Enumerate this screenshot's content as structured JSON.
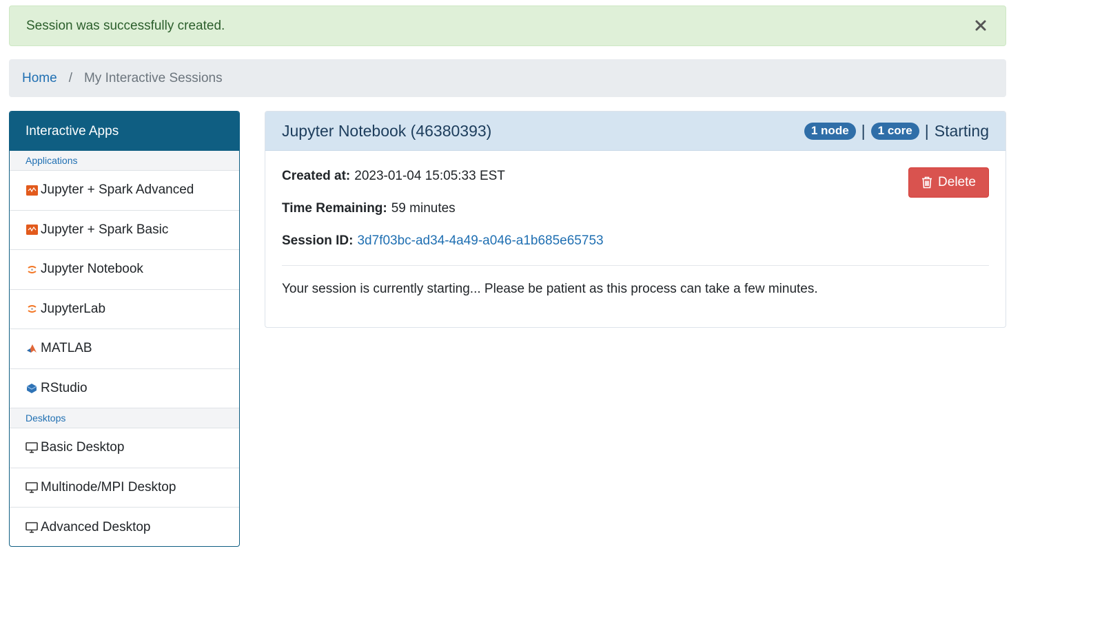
{
  "alert": {
    "message": "Session was successfully created.",
    "close_icon": "close-icon"
  },
  "breadcrumb": {
    "home": "Home",
    "separator": "/",
    "current": "My Interactive Sessions"
  },
  "sidebar": {
    "title": "Interactive Apps",
    "sections": [
      {
        "label": "Applications",
        "items": [
          {
            "label": "Jupyter + Spark Advanced",
            "icon": "spark-icon"
          },
          {
            "label": "Jupyter + Spark Basic",
            "icon": "spark-icon"
          },
          {
            "label": "Jupyter Notebook",
            "icon": "jupyter-icon"
          },
          {
            "label": "JupyterLab",
            "icon": "jupyter-icon"
          },
          {
            "label": "MATLAB",
            "icon": "matlab-icon"
          },
          {
            "label": "RStudio",
            "icon": "rstudio-icon"
          }
        ]
      },
      {
        "label": "Desktops",
        "items": [
          {
            "label": "Basic Desktop",
            "icon": "desktop-icon"
          },
          {
            "label": "Multinode/MPI Desktop",
            "icon": "desktop-icon"
          },
          {
            "label": "Advanced Desktop",
            "icon": "desktop-icon"
          }
        ]
      }
    ]
  },
  "session": {
    "title": "Jupyter Notebook (46380393)",
    "nodes_badge": "1 node",
    "cores_badge": "1 core",
    "pipe": "|",
    "status": "Starting",
    "created_label": "Created at:",
    "created_value": "2023-01-04 15:05:33 EST",
    "remaining_label": "Time Remaining:",
    "remaining_value": "59 minutes",
    "id_label": "Session ID:",
    "id_value": "3d7f03bc-ad34-4a49-a046-a1b685e65753",
    "message": "Your session is currently starting... Please be patient as this process can take a few minutes.",
    "delete_label": "Delete"
  },
  "colors": {
    "brand": "#0f5e82",
    "link": "#1f6fb2",
    "alert_bg": "#dff0d8",
    "badge": "#2f6ea8",
    "danger": "#d9534f"
  }
}
